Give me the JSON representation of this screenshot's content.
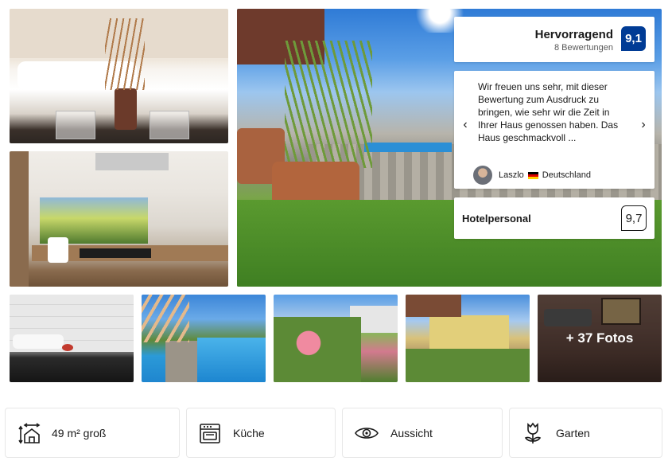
{
  "review_score": {
    "label": "Hervorragend",
    "count_text": "8 Bewertungen",
    "score": "9,1",
    "badge_color": "#003b95"
  },
  "review": {
    "text": "Wir freuen uns sehr, mit dieser Bewertung zum Ausdruck zu bringen, wie sehr wir die Zeit in Ihrer Haus genossen haben. Das Haus geschmackvoll ...",
    "reviewer_name": "Laszlo",
    "reviewer_country": "Deutschland",
    "prev_icon": "chevron-left-icon",
    "next_icon": "chevron-right-icon",
    "prev_glyph": "‹",
    "next_glyph": "›"
  },
  "staff": {
    "label": "Hotelpersonal",
    "score": "9,7"
  },
  "gallery": {
    "more_photos": "+ 37 Fotos"
  },
  "facilities": [
    {
      "label": "49 m² groß",
      "icon": "size-icon"
    },
    {
      "label": "Küche",
      "icon": "oven-icon"
    },
    {
      "label": "Aussicht",
      "icon": "eye-icon"
    },
    {
      "label": "Garten",
      "icon": "tulip-icon"
    }
  ]
}
